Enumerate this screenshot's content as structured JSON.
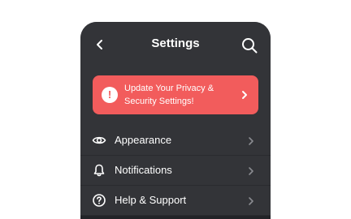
{
  "header": {
    "title": "Settings",
    "back_icon": "chevron-left-icon",
    "search_icon": "search-icon"
  },
  "banner": {
    "text_line1": "Update Your Privacy &",
    "text_line2": "Security Settings!",
    "alert_glyph": "!",
    "color": "#f25c5c",
    "icon": "alert-circle-icon",
    "chevron_icon": "chevron-right-icon"
  },
  "settings_list": {
    "items": [
      {
        "label": "Appearance",
        "icon": "eye-icon"
      },
      {
        "label": "Notifications",
        "icon": "bell-icon"
      },
      {
        "label": "Help & Support",
        "icon": "help-circle-icon"
      }
    ]
  },
  "colors": {
    "background": "#222327",
    "surface": "#333438",
    "text": "#ffffff",
    "muted_icon": "#8a8b90"
  }
}
